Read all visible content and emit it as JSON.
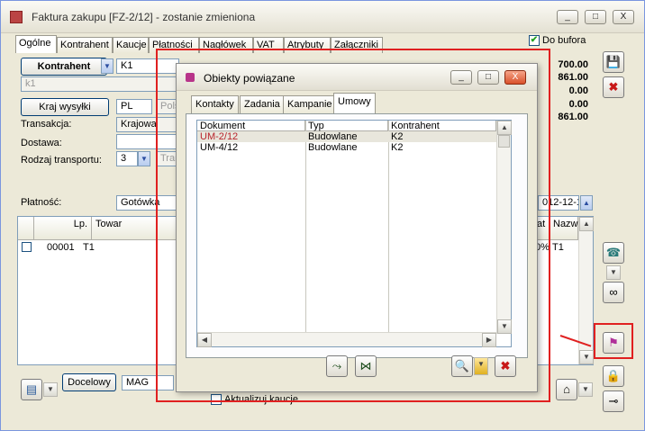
{
  "window": {
    "title": "Faktura zakupu [FZ-2/12]  - zostanie zmieniona",
    "controls": {
      "minimize": "_",
      "maximize": "□",
      "close": "X"
    }
  },
  "tabs": [
    "Ogólne",
    "Kontrahent",
    "Kaucje",
    "Płatności",
    "Nagłówek",
    "VAT",
    "Atrybuty",
    "Załączniki"
  ],
  "do_bufora": {
    "label": "Do bufora",
    "checked": true
  },
  "form": {
    "kontrahent_button": "Kontrahent",
    "kontrahent_code": "K1",
    "kontrahent_name": "k1",
    "kraj_wysylki_button": "Kraj wysyłki",
    "kraj_code": "PL",
    "kraj_name": "Pols",
    "transakcja_label": "Transakcja:",
    "transakcja_value": "Krajowa",
    "dostawa_label": "Dostawa:",
    "dostawa_value": "",
    "rodzaj_transportu_label": "Rodzaj transportu:",
    "rodzaj_transportu_value": "3",
    "rodzaj_transportu_text": "Tran",
    "platnosc_label": "Płatność:",
    "platnosc_value": "Gotówka",
    "date_value": "012-12-11"
  },
  "amounts": [
    "700.00",
    "861.00",
    "0.00",
    "0.00",
    "861.00"
  ],
  "grid": {
    "columns": [
      "Lp.",
      "Towar",
      "at",
      "Nazw"
    ],
    "rows": [
      {
        "lp": "00001",
        "towar": "T1",
        "vat": "0%",
        "nazwa": "T1"
      }
    ]
  },
  "bottom": {
    "docelowy_button": "Docelowy",
    "magazyn_value": "MAG",
    "aktualizuj_kaucje_label": "Aktualizuj kaucje"
  },
  "dialog": {
    "title": "Obiekty powiązane",
    "tabs": [
      "Kontakty",
      "Zadania",
      "Kampanie",
      "Umowy"
    ],
    "active_tab": "Umowy",
    "columns": [
      "Dokument",
      "Typ",
      "Kontrahent"
    ],
    "rows": [
      {
        "dokument": "UM-2/12",
        "typ": "Budowlane",
        "kontrahent": "K2",
        "selected": true
      },
      {
        "dokument": "UM-4/12",
        "typ": "Budowlane",
        "kontrahent": "K2",
        "selected": false
      }
    ],
    "controls": {
      "minimize": "_",
      "maximize": "□",
      "close": "X"
    }
  },
  "icons": [
    "save-icon",
    "delete-icon",
    "phone-icon",
    "binoculars-icon",
    "linked-objects-icon",
    "lock-icon",
    "pin-icon",
    "basket-icon",
    "document-icon",
    "magnifier-icon",
    "link-icon",
    "unlink-icon"
  ],
  "colors": {
    "highlight": "#e02020",
    "selected_row_text": "#b8242c",
    "window_bg": "#ece9d8"
  }
}
